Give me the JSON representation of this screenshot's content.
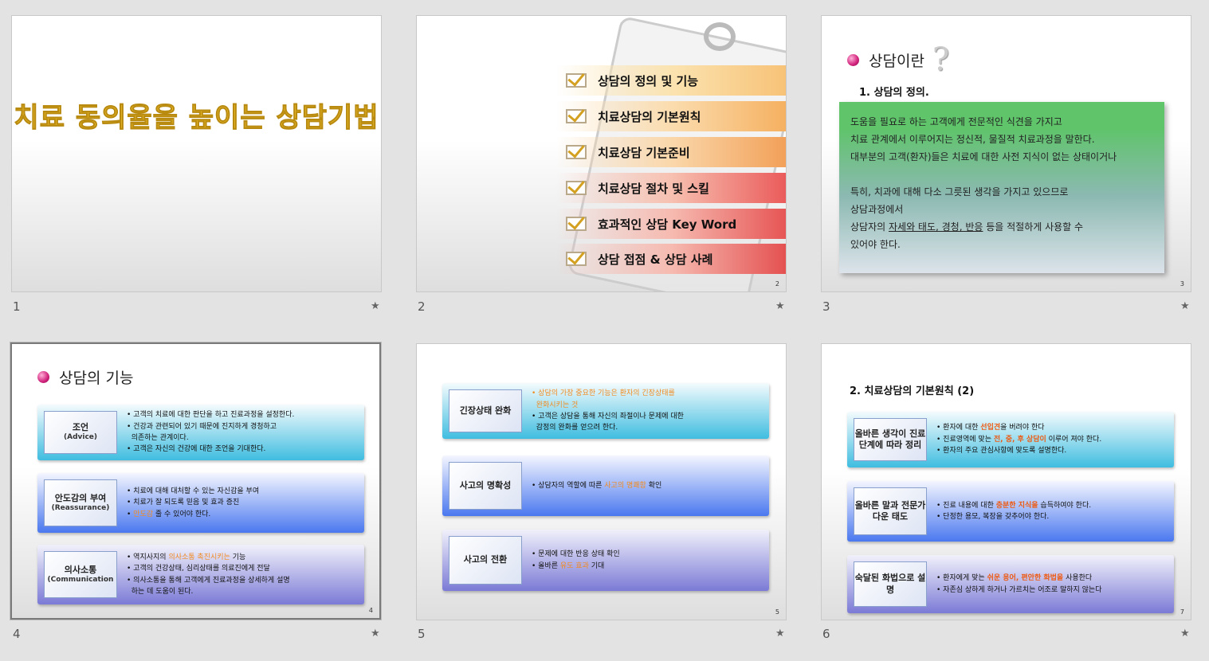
{
  "slides": [
    {
      "number": "1",
      "title": "치료 동의율을 높이는 상담기법"
    },
    {
      "number": "2",
      "page": "2",
      "items": [
        "상담의 정의 및 기능",
        "치료상담의 기본원칙",
        "치료상담 기본준비",
        "치료상담 절차 및 스킬",
        "효과적인 상담 Key Word",
        "상담 접점 & 상담 사례"
      ]
    },
    {
      "number": "3",
      "page": "3",
      "title": "상담이란",
      "question": "?",
      "subtitle": "1. 상담의 정의.",
      "lines": [
        "도움을 필요로 하는 고객에게 전문적인 식견을 가지고",
        "치료 관계에서 이루어지는 정신적, 물질적 치료과정을 말한다.",
        "대부분의 고객(환자)들은 치료에 대한 사전 지식이 없는 상태이거나",
        "",
        "특히, 치과에 대해 다소 그릇된 생각을 가지고 있으므로",
        "상담과정에서"
      ],
      "last_prefix": "상담자의 ",
      "last_underline": "자세와 태도, 경청, 반응",
      "last_suffix": " 등을 적절하게 사용할 수",
      "last_line": "있어야 한다."
    },
    {
      "number": "4",
      "page": "4",
      "title": "상담의 기능",
      "boxes": [
        {
          "label": "조언",
          "sub": "(Advice)",
          "lines": [
            [
              [
                "• 고객의 치료에 대한 판단을 하고 진료과정을 설정한다.",
                ""
              ]
            ],
            [
              [
                "• 건강과 관련되어 있기 때문에 진지하게 경청하고",
                ""
              ]
            ],
            [
              [
                "  의존하는 관계이다.",
                ""
              ]
            ],
            [
              [
                "• 고객은 자신의 건강에 대한 조언을 기대한다.",
                ""
              ]
            ]
          ]
        },
        {
          "label": "안도감의 부여",
          "sub": "(Reassurance)",
          "lines": [
            [
              [
                "• 치료에 대해 대처할 수 있는 자신감을 부여",
                ""
              ]
            ],
            [
              [
                "• 치료가 잘 되도록 믿음 및 효과 증진",
                ""
              ]
            ],
            [
              [
                "• ",
                ""
              ],
              [
                "안도감",
                "hl"
              ],
              [
                " 줄 수 있어야 한다.",
                ""
              ]
            ]
          ]
        },
        {
          "label": "의사소통",
          "sub": "(Communication",
          "lines": [
            [
              [
                "• 역지사지의 ",
                ""
              ],
              [
                "의사소통 촉진시키는",
                "hl"
              ],
              [
                " 기능",
                ""
              ]
            ],
            [
              [
                "• 고객의 건강상태, 심리상태를 의료진에게 전달",
                ""
              ]
            ],
            [
              [
                "• 의사소통을 통해 고객에게 진료과정을 상세하게 설명",
                ""
              ]
            ],
            [
              [
                "  하는 데 도움이 된다.",
                ""
              ]
            ]
          ]
        }
      ]
    },
    {
      "number": "5",
      "page": "5",
      "boxes": [
        {
          "label": "긴장상태 완화",
          "sub": "",
          "lines": [
            [
              [
                "• 상담의 가장 중요한 기능은 환자의 긴장상태를",
                "hl"
              ]
            ],
            [
              [
                "  완화시키는 것",
                "hl"
              ]
            ],
            [
              [
                "• 고객은 상담을 통해 자신의 좌절이나 문제에 대한",
                ""
              ]
            ],
            [
              [
                "  감정의 완화를 얻으려 한다.",
                ""
              ]
            ]
          ]
        },
        {
          "label": "사고의 명확성",
          "sub": "",
          "lines": [
            [
              [
                "• 상담자의 역할에 따른 ",
                ""
              ],
              [
                "사고의 명쾌함",
                "hl"
              ],
              [
                " 확인",
                ""
              ]
            ]
          ]
        },
        {
          "label": "사고의 전환",
          "sub": "",
          "lines": [
            [
              [
                "• 문제에 대한 반응 상태 확인",
                ""
              ]
            ],
            [
              [
                "• 올바른 ",
                ""
              ],
              [
                "유도 효과",
                "hl"
              ],
              [
                " 기대",
                ""
              ]
            ]
          ]
        }
      ]
    },
    {
      "number": "6",
      "page": "7",
      "title": "2. 치료상담의 기본원칙 (2)",
      "boxes": [
        {
          "label": "올바른 생각이 진료단계에 따라 정리",
          "sub": "",
          "lines": [
            [
              [
                "• 환자에 대한 ",
                ""
              ],
              [
                "선입견",
                "hb"
              ],
              [
                "을 버려야 한다",
                ""
              ]
            ],
            [
              [
                "• 진료영역에 맞는 ",
                ""
              ],
              [
                "전, 중, 후 상담이",
                "hb"
              ],
              [
                " 이루어 져야 한다.",
                ""
              ]
            ],
            [
              [
                "• 환자의 주요 관심사항에 맞도록 설명한다.",
                ""
              ]
            ]
          ]
        },
        {
          "label": "올바른 말과 전문가다운 태도",
          "sub": "",
          "lines": [
            [
              [
                "• 진료 내용에 대한 ",
                ""
              ],
              [
                "충분한 지식을",
                "hb"
              ],
              [
                " 습득하여야 한다.",
                ""
              ]
            ],
            [
              [
                "• 단정한 용모, 복장을 갖추어야 한다.",
                ""
              ]
            ]
          ]
        },
        {
          "label": "숙달된 화법으로 설명",
          "sub": "",
          "lines": [
            [
              [
                "• 환자에게 맞는 ",
                ""
              ],
              [
                "쉬운 용어, 편안한 화법을",
                "hb"
              ],
              [
                " 사용한다",
                ""
              ]
            ],
            [
              [
                "• 자존심 상하게 하거나 가르치는 어조로 말하지 않는다",
                ""
              ]
            ]
          ]
        }
      ]
    }
  ]
}
